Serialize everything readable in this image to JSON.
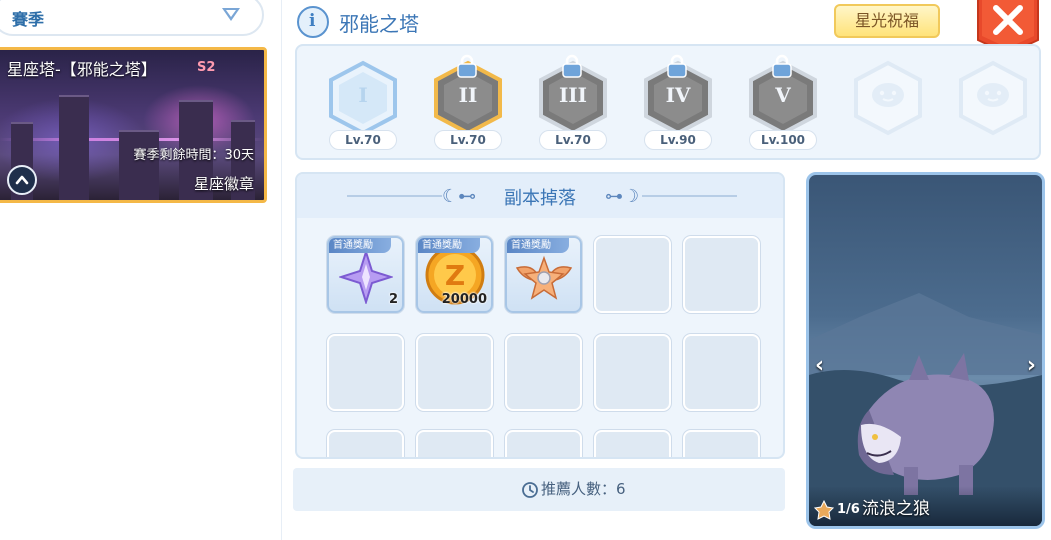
{
  "sidebar": {
    "season_label": "賽季",
    "tower": {
      "name": "星座塔-【邪能之塔】",
      "season_tag": "S2",
      "remaining": "賽季剩餘時間：30天",
      "badge_label": "星座徽章"
    }
  },
  "header": {
    "title": "邪能之塔",
    "info_glyph": "i",
    "bless_button": "星光祝福"
  },
  "levels": [
    {
      "roman": "I",
      "lv": "Lv.70",
      "state": "unlocked"
    },
    {
      "roman": "II",
      "lv": "Lv.70",
      "state": "locked-selected"
    },
    {
      "roman": "III",
      "lv": "Lv.70",
      "state": "locked"
    },
    {
      "roman": "IV",
      "lv": "Lv.90",
      "state": "locked"
    },
    {
      "roman": "V",
      "lv": "Lv.100",
      "state": "locked"
    },
    {
      "roman": "",
      "lv": "",
      "state": "hidden"
    },
    {
      "roman": "",
      "lv": "",
      "state": "hidden"
    }
  ],
  "drops": {
    "title": "副本掉落",
    "first_clear_tag": "首通獎勵",
    "items": [
      {
        "icon": "purple-crystal-icon",
        "qty": "2"
      },
      {
        "icon": "gold-coin-icon",
        "qty": "20000"
      },
      {
        "icon": "wing-badge-icon",
        "qty": ""
      }
    ]
  },
  "recommend": {
    "text": "推薦人數：6"
  },
  "monster": {
    "page": "1/6",
    "name": "流浪之狼"
  },
  "colors": {
    "accent": "#3b76b6",
    "gold_border": "#f4b847",
    "close_red": "#e8492b"
  }
}
